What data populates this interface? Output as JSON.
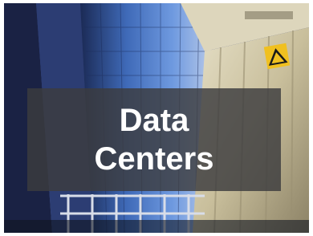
{
  "caption": {
    "line1": "Data",
    "line2": "Centers"
  },
  "colors": {
    "sky": "#3b4c8f",
    "tower_glass": "#4a78c4",
    "tower_shadow": "#18203a",
    "container_beige": "#cfc7a6",
    "caption_bg": "#3c3c3e",
    "caption_text": "#ffffff",
    "warning_sign": "#f0c020"
  },
  "scene_elements": [
    "skyscraper",
    "shipping-container",
    "warning-sign",
    "railing"
  ]
}
